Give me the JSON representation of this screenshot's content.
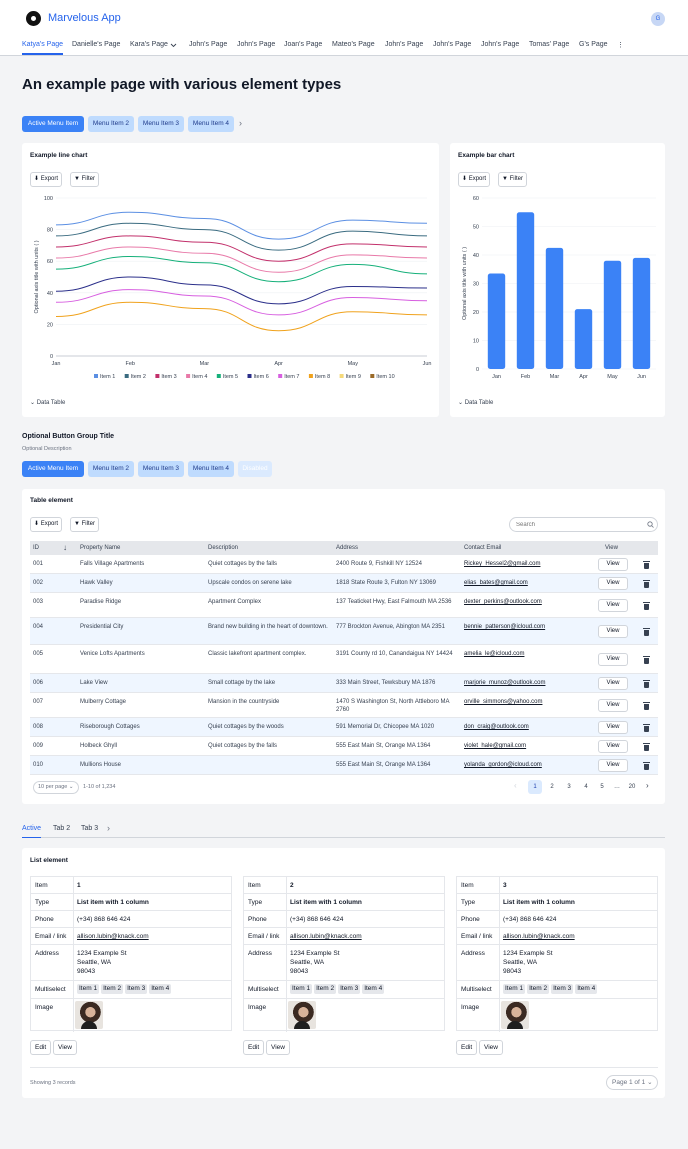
{
  "app": {
    "title": "Marvelous App",
    "avatar": "G"
  },
  "nav": {
    "tabs": [
      "Katya's Page",
      "Danielle's Page",
      "Kara's Page",
      "John's Page",
      "John's Page",
      "Joan's Page",
      "Mateo's Page",
      "John's Page",
      "John's Page",
      "John's Page",
      "Tomas' Page",
      "G's Page"
    ],
    "more": "⋮"
  },
  "page": {
    "title": "An example page with various element types"
  },
  "menu1": {
    "items": [
      "Active Menu Item",
      "Menu Item 2",
      "Menu Item 3",
      "Menu Item 4"
    ],
    "next": "›"
  },
  "toolbar": {
    "export": "Export",
    "filter": "Filter"
  },
  "line_card": {
    "title": "Example line chart",
    "toggle": "Data Table"
  },
  "bar_card": {
    "title": "Example bar chart",
    "toggle": "Data Table"
  },
  "chart_data": [
    {
      "type": "line",
      "title": "Example line chart",
      "ylabel": "Optional axis title with units ( )",
      "ylim": [
        0,
        100
      ],
      "yticks": [
        0,
        20,
        40,
        60,
        80,
        100
      ],
      "categories": [
        "Jan",
        "Feb",
        "Mar",
        "Apr",
        "May",
        "Jun"
      ],
      "legend": "bottom",
      "series": [
        {
          "name": "Item 1",
          "color": "#5b8fe3",
          "values": [
            83,
            91,
            87,
            74,
            86,
            84
          ]
        },
        {
          "name": "Item 2",
          "color": "#3a6b80",
          "values": [
            76,
            84,
            80,
            67,
            79,
            76
          ]
        },
        {
          "name": "Item 3",
          "color": "#c2306b",
          "values": [
            69,
            76,
            72,
            60,
            71,
            69
          ]
        },
        {
          "name": "Item 4",
          "color": "#e879a8",
          "values": [
            62,
            69,
            65,
            53,
            64,
            62
          ]
        },
        {
          "name": "Item 5",
          "color": "#16b07a",
          "values": [
            55,
            63,
            59,
            47,
            58,
            52
          ]
        },
        {
          "name": "Item 6",
          "color": "#2b2f8a",
          "values": [
            41,
            50,
            45,
            33,
            44,
            43
          ]
        },
        {
          "name": "Item 7",
          "color": "#d75fe0",
          "values": [
            34,
            42,
            38,
            26,
            37,
            35
          ]
        },
        {
          "name": "Item 8",
          "color": "#f0a21c",
          "values": [
            25,
            34,
            30,
            16,
            28,
            26
          ]
        },
        {
          "name": "Item 9",
          "color": "#f5d97a",
          "values": [
            null,
            null,
            null,
            null,
            null,
            null
          ]
        },
        {
          "name": "Item 10",
          "color": "#9a6a28",
          "values": [
            null,
            null,
            null,
            null,
            null,
            null
          ]
        }
      ]
    },
    {
      "type": "bar",
      "title": "Example bar chart",
      "ylabel": "Optional axis title with units ( )",
      "ylim": [
        0,
        60
      ],
      "yticks": [
        0,
        10,
        20,
        30,
        40,
        50,
        60
      ],
      "categories": [
        "Jan",
        "Feb",
        "Mar",
        "Apr",
        "May",
        "Jun"
      ],
      "values": [
        33.5,
        55,
        42.5,
        21,
        38,
        39
      ],
      "color": "#3b82f6"
    }
  ],
  "group": {
    "title": "Optional Button Group Title",
    "desc": "Optional Description",
    "items": [
      "Active Menu Item",
      "Menu Item 2",
      "Menu Item 3",
      "Menu Item 4",
      "Disabled"
    ]
  },
  "table": {
    "title": "Table element",
    "search_placeholder": "Search",
    "headers": [
      "ID",
      "Property Name",
      "Description",
      "Address",
      "Contact Email",
      "View"
    ],
    "view_label": "View",
    "rows": [
      {
        "id": "001",
        "name": "Falls Village Apartments",
        "desc": "Quiet cottages by the falls",
        "addr": "2400 Route 9, Fishkill NY 12524",
        "email": "Rickey_Hessel2@gmail.com"
      },
      {
        "id": "002",
        "name": "Hawk Valley",
        "desc": "Upscale condos on serene lake",
        "addr": "1818 State Route 3, Fulton NY 13069",
        "email": "elias_bates@gmail.com"
      },
      {
        "id": "003",
        "name": "Paradise Ridge",
        "desc": "Apartment Complex",
        "addr": "137 Teaticket Hwy, East Falmouth MA 2536",
        "email": "dexter_perkins@outlook.com"
      },
      {
        "id": "004",
        "name": "Presidential City",
        "desc": "Brand new building in the heart of downtown.",
        "addr": "777 Brockton Avenue, Abington MA 2351",
        "email": "bennie_patterson@icloud.com"
      },
      {
        "id": "005",
        "name": "Venice Lofts Apartments",
        "desc": "Classic lakefront apartment complex.",
        "addr": "3191 County rd 10, Canandaigua NY 14424",
        "email": "amelia_le@icloud.com"
      },
      {
        "id": "006",
        "name": "Lake View",
        "desc": "Small  cottage by the lake",
        "addr": "333 Main Street, Tewksbury MA 1876",
        "email": "marjorie_munoz@outlook.com"
      },
      {
        "id": "007",
        "name": "Mulberry Cottage",
        "desc": "Mansion in the countryside",
        "addr": "1470 S Washington St, North Attleboro MA 2760",
        "email": "orville_simmons@yahoo.com"
      },
      {
        "id": "008",
        "name": "Riseborough Cottages",
        "desc": "Quiet cottages by the woods",
        "addr": "591 Memorial Dr, Chicopee MA 1020",
        "email": "don_craig@outlook.com"
      },
      {
        "id": "009",
        "name": "Holbeck Ghyll",
        "desc": "Quiet cottages by the falls",
        "addr": "555 East Main St, Orange MA 1364",
        "email": "violet_hale@gmail.com"
      },
      {
        "id": "010",
        "name": "Mullions House",
        "desc": "",
        "addr": "555 East Main St, Orange MA 1364",
        "email": "yolanda_gordon@icloud.com"
      }
    ],
    "per_page": "10 per page",
    "range": "1-10 of 1,234",
    "pages": [
      "1",
      "2",
      "3",
      "4",
      "5",
      "…",
      "20"
    ]
  },
  "tabs2": {
    "items": [
      "Active",
      "Tab 2",
      "Tab 3"
    ],
    "next": "›"
  },
  "list": {
    "title": "List element",
    "keys": [
      "Item",
      "Type",
      "Phone",
      "Email / link",
      "Address",
      "Multiselect",
      "Image"
    ],
    "items": [
      {
        "item": "1",
        "type": "List item with 1 column",
        "phone": "(+34) 868 646 424",
        "email": "allison.lubin@knack.com",
        "addr1": "1234 Example St",
        "addr2": "Seattle, WA",
        "addr3": "98043",
        "tags": [
          "Item 1",
          "Item 2",
          "Item 3",
          "Item 4"
        ]
      },
      {
        "item": "2",
        "type": "List item with 1 column",
        "phone": "(+34) 868 646 424",
        "email": "allison.lubin@knack.com",
        "addr1": "1234 Example St",
        "addr2": "Seattle, WA",
        "addr3": "98043",
        "tags": [
          "Item 1",
          "Item 2",
          "Item 3",
          "Item 4"
        ]
      },
      {
        "item": "3",
        "type": "List item with 1 column",
        "phone": "(+34) 868 646 424",
        "email": "allison.lubin@knack.com",
        "addr1": "1234 Example St",
        "addr2": "Seattle, WA",
        "addr3": "98043",
        "tags": [
          "Item 1",
          "Item 2",
          "Item 3",
          "Item 4"
        ]
      }
    ],
    "edit": "Edit",
    "view": "View",
    "showing": "Showing 3 records",
    "pager": "Page 1 of 1"
  }
}
